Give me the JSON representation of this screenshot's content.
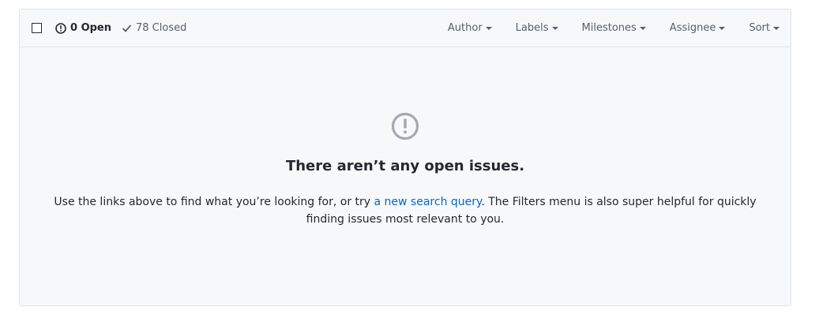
{
  "header": {
    "open_count_label": "0 Open",
    "closed_count_label": "78 Closed",
    "filters": [
      {
        "label": "Author"
      },
      {
        "label": "Labels"
      },
      {
        "label": "Milestones"
      },
      {
        "label": "Assignee"
      },
      {
        "label": "Sort"
      }
    ]
  },
  "blankslate": {
    "icon": "issue-opened-icon",
    "title": "There aren’t any open issues.",
    "text_before": "Use the links above to find what you’re looking for, or try ",
    "link_text": "a new search query",
    "text_after": ". The Filters menu is also super helpful for quickly finding issues most relevant to you."
  },
  "colors": {
    "link": "#0366d6",
    "icon_gray": "#a3aab1",
    "muted": "#586069"
  }
}
